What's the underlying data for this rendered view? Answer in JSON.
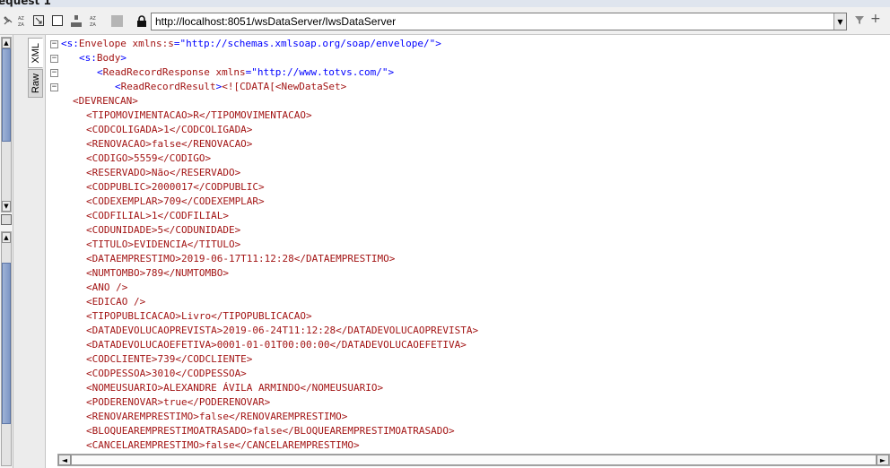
{
  "window": {
    "title": "equest 1"
  },
  "toolbar": {
    "icons": [
      "pin-icon",
      "sort-az-icon",
      "expand-icon",
      "stop-icon",
      "tree-icon",
      "sort-icon",
      "block-icon",
      "lock-icon"
    ],
    "url": "http://localhost:8051/wsDataServer/IwsDataServer"
  },
  "tabs": {
    "xml_label": "XML",
    "raw_label": "Raw"
  },
  "code": {
    "envelope_line": {
      "open": "<",
      "prefix": "s:",
      "name": "Envelope",
      "attr": " xmlns:s",
      "eq": "=",
      "value": "\"http://schemas.xmlsoap.org/soap/envelope/\"",
      "close": ">"
    },
    "body_line": {
      "open": "<",
      "prefix": "s:",
      "name": "Body",
      "close": ">"
    },
    "response_line": {
      "open": "<",
      "name": "ReadRecordResponse",
      "attr": " xmlns",
      "eq": "=",
      "value": "\"http://www.totvs.com/\"",
      "close": ">"
    },
    "result_line": {
      "open": "<",
      "name": "ReadRecordResult",
      "close": ">",
      "cdata": "<![CDATA[<NewDataSet>"
    },
    "lines": [
      "<DEVRENCAN>",
      "<TIPOMOVIMENTACAO>R</TIPOMOVIMENTACAO>",
      "<CODCOLIGADA>1</CODCOLIGADA>",
      "<RENOVACAO>false</RENOVACAO>",
      "<CODIGO>5559</CODIGO>",
      "<RESERVADO>Não</RESERVADO>",
      "<CODPUBLIC>2000017</CODPUBLIC>",
      "<CODEXEMPLAR>709</CODEXEMPLAR>",
      "<CODFILIAL>1</CODFILIAL>",
      "<CODUNIDADE>5</CODUNIDADE>",
      "<TITULO>EVIDENCIA</TITULO>",
      "<DATAEMPRESTIMO>2019-06-17T11:12:28</DATAEMPRESTIMO>",
      "<NUMTOMBO>789</NUMTOMBO>",
      "<ANO />",
      "<EDICAO />",
      "<TIPOPUBLICACAO>Livro</TIPOPUBLICACAO>",
      "<DATADEVOLUCAOPREVISTA>2019-06-24T11:12:28</DATADEVOLUCAOPREVISTA>",
      "<DATADEVOLUCAOEFETIVA>0001-01-01T00:00:00</DATADEVOLUCAOEFETIVA>",
      "<CODCLIENTE>739</CODCLIENTE>",
      "<CODPESSOA>3010</CODPESSOA>",
      "<NOMEUSUARIO>ALEXANDRE ÁVILA ARMINDO</NOMEUSUARIO>",
      "<PODERENOVAR>true</PODERENOVAR>",
      "<RENOVAREMPRESTIMO>false</RENOVAREMPRESTIMO>",
      "<BLOQUEAREMPRESTIMOATRASADO>false</BLOQUEAREMPRESTIMOATRASADO>",
      "<CANCELAREMPRESTIMO>false</CANCELAREMPRESTIMO>"
    ]
  },
  "colors": {
    "tag": "#a31515",
    "namespace": "#0000ff",
    "value": "#0000ff"
  }
}
